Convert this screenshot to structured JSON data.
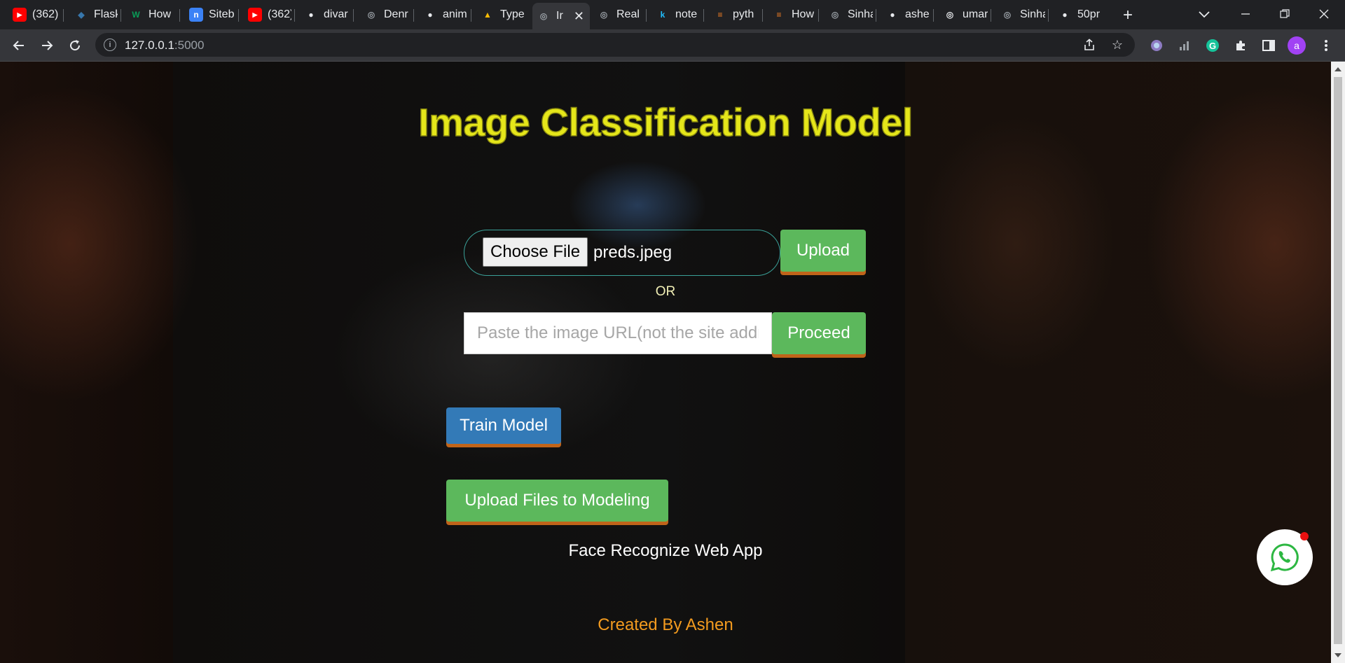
{
  "browser": {
    "tabs": [
      {
        "label": "(362)",
        "favicon": "youtube-icon",
        "color": "#ff0000"
      },
      {
        "label": "Flask",
        "favicon": "python-icon",
        "color": "#3776ab"
      },
      {
        "label": "How",
        "favicon": "w-icon",
        "color": "#0a9d58"
      },
      {
        "label": "Siteb",
        "favicon": "n-icon",
        "color": "#3b82f6"
      },
      {
        "label": "(362)",
        "favicon": "youtube-icon",
        "color": "#ff0000"
      },
      {
        "label": "divar",
        "favicon": "github-icon",
        "color": "#e8eaed"
      },
      {
        "label": "Denr",
        "favicon": "globe-icon",
        "color": "#9aa0a6"
      },
      {
        "label": "anim",
        "favicon": "github-icon",
        "color": "#e8eaed"
      },
      {
        "label": "Type",
        "favicon": "drive-icon",
        "color": "#fbbc04"
      },
      {
        "label": "Ir",
        "favicon": "globe-icon",
        "color": "#9aa0a6",
        "active": true
      },
      {
        "label": "Real",
        "favicon": "globe-icon",
        "color": "#9aa0a6"
      },
      {
        "label": "note",
        "favicon": "k-icon",
        "color": "#20beff"
      },
      {
        "label": "pyth",
        "favicon": "stackoverflow-icon",
        "color": "#f48024"
      },
      {
        "label": "How",
        "favicon": "stackoverflow-icon",
        "color": "#f48024"
      },
      {
        "label": "Sinha",
        "favicon": "globe-icon",
        "color": "#9aa0a6"
      },
      {
        "label": "ashe",
        "favicon": "github-icon",
        "color": "#e8eaed"
      },
      {
        "label": "umar",
        "favicon": "globe-icon",
        "color": "#e8eaed"
      },
      {
        "label": "Sinha",
        "favicon": "globe-icon",
        "color": "#9aa0a6"
      },
      {
        "label": "50pr",
        "favicon": "github-icon",
        "color": "#e8eaed"
      }
    ],
    "url_host": "127.0.0.1",
    "url_port": ":5000",
    "avatar_letter": "a"
  },
  "page": {
    "title": "Image Classification Model",
    "choose_file_label": "Choose File",
    "file_name": "preds.jpeg",
    "upload_label": "Upload",
    "or_label": "OR",
    "url_placeholder": "Paste the image URL(not the site address)",
    "proceed_label": "Proceed",
    "train_label": "Train Model",
    "upload_files_label": "Upload Files to Modeling",
    "face_link": "Face Recognize Web App",
    "credit": "Created By Ashen"
  },
  "colors": {
    "title": "#e5e61a",
    "green_button": "#5cb85c",
    "blue_button": "#337ab7",
    "button_shadow": "#c0641a",
    "credit": "#f29a1f",
    "file_box_border": "#3aa198"
  }
}
